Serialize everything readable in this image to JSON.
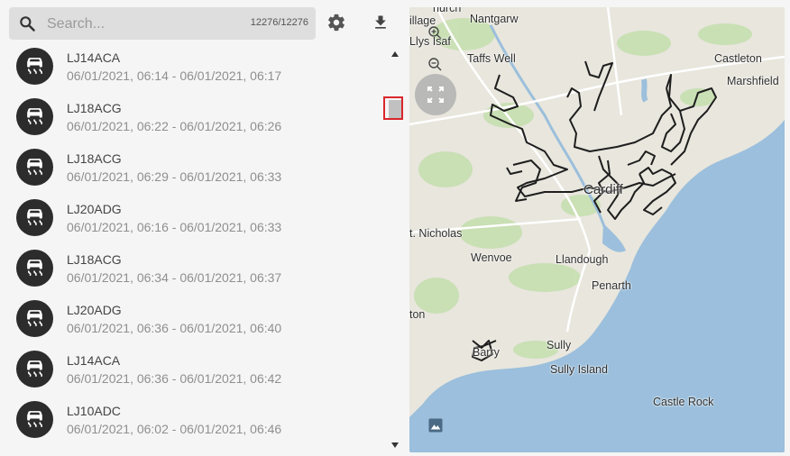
{
  "search": {
    "placeholder": "Search...",
    "value": "",
    "count": "12276/12276"
  },
  "items": [
    {
      "plate": "LJ14ACA",
      "time": "06/01/2021, 06:14 - 06/01/2021, 06:17"
    },
    {
      "plate": "LJ18ACG",
      "time": "06/01/2021, 06:22 - 06/01/2021, 06:26"
    },
    {
      "plate": "LJ18ACG",
      "time": "06/01/2021, 06:29 - 06/01/2021, 06:33"
    },
    {
      "plate": "LJ20ADG",
      "time": "06/01/2021, 06:16 - 06/01/2021, 06:33"
    },
    {
      "plate": "LJ18ACG",
      "time": "06/01/2021, 06:34 - 06/01/2021, 06:37"
    },
    {
      "plate": "LJ20ADG",
      "time": "06/01/2021, 06:36 - 06/01/2021, 06:40"
    },
    {
      "plate": "LJ14ACA",
      "time": "06/01/2021, 06:36 - 06/01/2021, 06:42"
    },
    {
      "plate": "LJ10ADC",
      "time": "06/01/2021, 06:02 - 06/01/2021, 06:46"
    }
  ],
  "map": {
    "labels": {
      "nantgarw": "Nantgarw",
      "church": "hurch",
      "village": "illage",
      "isaf": "Llys Isaf",
      "taffs_well": "Taffs Well",
      "castleton": "Castleton",
      "marshfield": "Marshfield",
      "cardiff": "Cardiff",
      "st_nicholas": "t. Nicholas",
      "wenvoe": "Wenvoe",
      "llandough": "Llandough",
      "penarth": "Penarth",
      "ton": "ton",
      "sully": "Sully",
      "barry": "Barry",
      "sully_island": "Sully Island",
      "castle_rock": "Castle Rock"
    },
    "colors": {
      "sea": "#9bbfdc",
      "land": "#e8e6dd",
      "green": "#c6dfb0",
      "route": "#1e1e1e"
    }
  },
  "icons": {
    "search": "search-icon",
    "settings": "gear-icon",
    "download": "download-icon",
    "avatar": "vehicle-skid-icon",
    "zoom_in": "zoom-in-icon",
    "zoom_out": "zoom-out-icon",
    "fullscreen": "fullscreen-icon",
    "layers": "image-layers-icon"
  }
}
